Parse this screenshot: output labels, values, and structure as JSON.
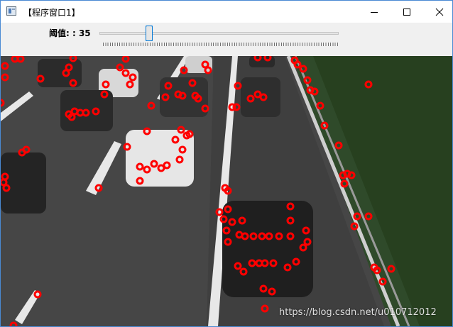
{
  "window": {
    "title": "【程序窗口1】",
    "accent_color": "#4a8ad4"
  },
  "titlebar_buttons": {
    "minimize_icon": "minimize-icon",
    "maximize_icon": "maximize-icon",
    "close_icon": "close-icon"
  },
  "trackbar": {
    "label": "阈值: : 35",
    "value": 35
  },
  "image": {
    "description_icon": "road-scene-image",
    "marker_color": "#ff0000",
    "watermark": "https://blog.csdn.net/u010712012"
  }
}
